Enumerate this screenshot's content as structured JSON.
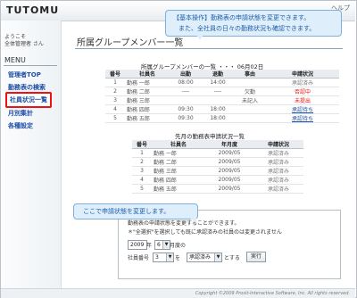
{
  "app": {
    "logo": "TUTOMU",
    "help_link": "ヘルプ"
  },
  "sidebar": {
    "welcome_line1": "ようこそ",
    "welcome_line2": "全体管理者 さん",
    "menu_title": "MENU",
    "items": [
      {
        "label": "管理者TOP"
      },
      {
        "label": "勤務表の検索"
      },
      {
        "label": "社員状況一覧",
        "active": true
      },
      {
        "label": "月別集計"
      },
      {
        "label": "各種設定"
      }
    ]
  },
  "page": {
    "title": "所属グループメンバー一覧"
  },
  "callouts": {
    "top_line1": "【基本操作】勤務表の申請状態を変更できます。",
    "top_line2": "また、全社員の日々の勤務状況も確認できます。",
    "left_line1": "ここで申請状態を変更します。"
  },
  "members_table": {
    "caption": "所属グループメンバーの一覧 ・・・ 06月02日",
    "headers": [
      "番号",
      "社員名",
      "出勤",
      "退勤",
      "事由",
      "申請状況"
    ],
    "rows": [
      {
        "no": "1",
        "name": "勤務 一郎",
        "in": "08:00",
        "out": "14:00",
        "reason": "",
        "status": "承認済み",
        "status_type": "gray"
      },
      {
        "no": "2",
        "name": "勤務 二郎",
        "in": "----",
        "out": "----",
        "reason": "欠勤",
        "status": "否認中",
        "status_type": "red"
      },
      {
        "no": "3",
        "name": "勤務 三郎",
        "in": "",
        "out": "",
        "reason": "未記入",
        "status": "未提出",
        "status_type": "red"
      },
      {
        "no": "4",
        "name": "勤務 四郎",
        "in": "09:30",
        "out": "18:00",
        "reason": "",
        "status": "承認待ち",
        "status_type": "blue"
      },
      {
        "no": "5",
        "name": "勤務 五郎",
        "in": "09:30",
        "out": "18:00",
        "reason": "",
        "status": "承認待ち",
        "status_type": "blue"
      }
    ]
  },
  "monthly_table": {
    "caption": "先月の勤務表申請状況一覧",
    "headers": [
      "番号",
      "社員名",
      "年月度",
      "申請状況"
    ],
    "rows": [
      {
        "no": "1",
        "name": "勤務 一郎",
        "ym": "2009/05",
        "status": "承認済み"
      },
      {
        "no": "2",
        "name": "勤務 二郎",
        "ym": "2009/05",
        "status": "承認済み"
      },
      {
        "no": "3",
        "name": "勤務 三郎",
        "ym": "2009/05",
        "status": "承認済み"
      },
      {
        "no": "4",
        "name": "勤務 四郎",
        "ym": "2009/05",
        "status": "承認済み"
      },
      {
        "no": "5",
        "name": "勤務 五郎",
        "ym": "2009/05",
        "status": "承認済み"
      }
    ]
  },
  "status_form": {
    "line1": "勤務表の申請状態を変更することができます。",
    "line2": "＊\"全選択\"を選択しても既に承認済みの社員のは変更されません",
    "year_value": "2009",
    "year_suffix": "年",
    "month_value": "6",
    "month_suffix": "月度の",
    "emp_label": "社員番号",
    "emp_value": "3",
    "wo": "を",
    "status_value": "承認済み",
    "suru": "とする",
    "submit": "実行"
  },
  "footer": {
    "copyright": "Copyright ©2009 Prosit-Interactive Software, Inc. All rights reserved."
  },
  "colors": {
    "accent_link": "#1d4fa6",
    "alert_red": "#e11111",
    "callout_bg": "#dfeefb"
  }
}
